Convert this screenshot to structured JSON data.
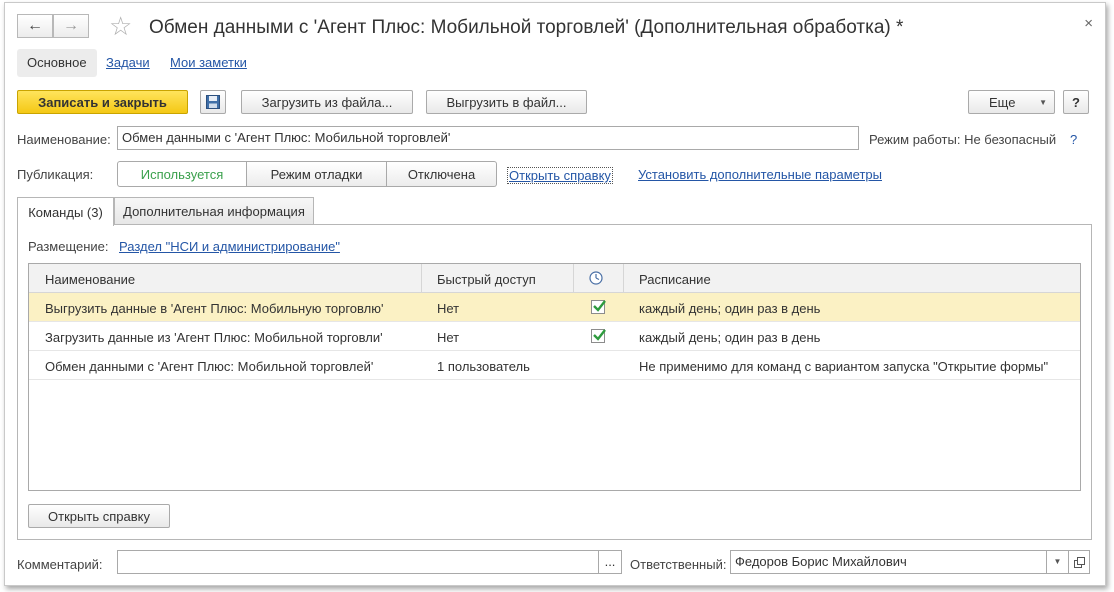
{
  "window": {
    "title": "Обмен данными с 'Агент Плюс: Мобильной торговлей' (Дополнительная обработка) *"
  },
  "nav": {
    "back_icon": "←",
    "forward_icon": "→",
    "star_icon": "☆",
    "close_icon": "×"
  },
  "section_tabs": [
    {
      "label": "Основное"
    },
    {
      "label": "Задачи"
    },
    {
      "label": "Мои заметки"
    }
  ],
  "toolbar": {
    "save_close": "Записать и закрыть",
    "load_file": "Загрузить из файла...",
    "unload_file": "Выгрузить в файл...",
    "more": "Еще",
    "help": "?"
  },
  "name_field": {
    "label": "Наименование:",
    "value": "Обмен данными с 'Агент Плюс: Мобильной торговлей'"
  },
  "mode": {
    "text": "Режим работы: Не безопасный",
    "help": "?"
  },
  "publication": {
    "label": "Публикация:",
    "options": [
      "Используется",
      "Режим отладки",
      "Отключена"
    ],
    "selected": "Используется"
  },
  "links": {
    "open_help": "Открыть справку",
    "set_params": "Установить дополнительные параметры"
  },
  "page_tabs": [
    {
      "label": "Команды (3)"
    },
    {
      "label": "Дополнительная информация"
    }
  ],
  "placement": {
    "label": "Размещение:",
    "value": "Раздел \"НСИ и администрирование\""
  },
  "table": {
    "headers": [
      "Наименование",
      "Быстрый доступ",
      "",
      "Расписание"
    ],
    "rows": [
      {
        "name": "Выгрузить данные в 'Агент Плюс: Мобильную торговлю'",
        "quick": "Нет",
        "checked": true,
        "schedule": "каждый день; один раз в день"
      },
      {
        "name": "Загрузить данные из 'Агент Плюс: Мобильной торговли'",
        "quick": "Нет",
        "checked": true,
        "schedule": "каждый день; один раз в день"
      },
      {
        "name": "Обмен данными с 'Агент Плюс: Мобильной торговлей'",
        "quick": "1 пользователь",
        "checked": false,
        "schedule": "Не применимо для команд с вариантом запуска \"Открытие формы\""
      }
    ]
  },
  "panel_button": "Открыть справку",
  "footer": {
    "comment_label": "Комментарий:",
    "comment_value": "",
    "ellipsis": "...",
    "responsible_label": "Ответственный:",
    "responsible_value": "Федоров Борис Михайлович"
  },
  "colors": {
    "accent_yellow": "#f4c815",
    "link_blue": "#2456a6",
    "selected_row": "#fbf1c4",
    "check_green": "#2e9b3e",
    "used_green": "#3aa04c"
  }
}
